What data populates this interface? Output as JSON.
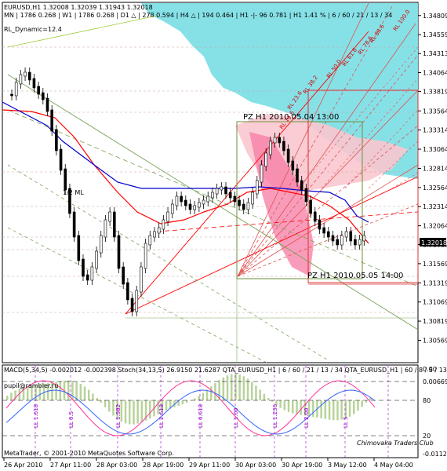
{
  "header": {
    "symbol_line": "EURUSD,H1  1.32008 1.32039 1.31943 1.32018",
    "timeframe_line": "MN | 1786   0.268 | W1 | 1786   0.268 | D1 △ | 278   0.594 | H4 △ | 194   0.464 | H1 -|- 96   0.781 | H1  1.41 %  | 6 / 60 / 21 / 13 / 34",
    "indicator_name": "RL_Dynamic=12.4",
    "subwindow_line": "MACD(5,34,5) -0.002012 -0.002398   Stoch(34,13,5) 26.9150 21.6287   QTA_EURUSD_H1  | 6 / 60 / 21 / 13 / 34   QTA_EURUSD_H1  | 60 / 8 / 5 / 13",
    "email_line": "pupil@rambler.ru",
    "copyright": "MetaTrader, © 2001-2010 MetaQuotes Software Corp.",
    "club": "Chimovaka Traders Club"
  },
  "annotations": {
    "pz_top": "PZ H1  2010.05.04 13:00",
    "pz_bottom": "PZ H1   2010.05.05 14:00",
    "ml_label": "1/2 ML",
    "fan_labels": [
      "RL 100.0",
      "RL 88.6",
      "RL 78.6",
      "RL 61.8",
      "RL 50.0",
      "RL 38.2",
      "RL 23.6",
      "RL 14.6"
    ],
    "sub_labels": [
      "LL 1.618",
      "LL 0.5",
      "LL 1.382",
      "LL 2.618",
      "LL 0.618",
      "LL 1.00",
      "LL 1.236",
      "LL 2.00",
      "LL 5"
    ]
  },
  "colors": {
    "cyan_cloud": "#7fdfe6",
    "pink_cloud": "#f9c7cf",
    "pink_strong": "#f77ba4",
    "median_red": "#ff0000",
    "median_blue": "#0000cc",
    "green_channel": "#7aa35a",
    "bull_candle": "#ffffff",
    "bear_candle": "#000000",
    "stoch_main": "#ff3399",
    "stoch_signal": "#3366ff",
    "macd_hist": "#b8d39a"
  },
  "chart_data": {
    "type": "candlestick",
    "title": "EURUSD,H1",
    "y_axis": {
      "ticks": [
        "1.34809",
        "1.34559",
        "1.34313",
        "1.34064",
        "1.33819",
        "1.33564",
        "1.33314",
        "1.33064",
        "1.32814",
        "1.32564",
        "1.32314",
        "1.32064",
        "1.32018",
        "1.31819",
        "1.31569",
        "1.31319",
        "1.31069",
        "1.30819",
        "1.30569"
      ],
      "range": [
        1.3042,
        1.3494
      ],
      "current_price": 1.32018
    },
    "sub_y_axis": {
      "ticks": [
        "0.00",
        "0.006695",
        "80",
        "20",
        "-0.01123"
      ]
    },
    "x_axis": {
      "labels": [
        "26 Apr 2010",
        "27 Apr 11:00",
        "28 Apr 03:00",
        "28 Apr 19:00",
        "29 Apr 11:00",
        "30 Apr 03:00",
        "30 Apr 19:00",
        "3 May 12:00",
        "4 May 04:00"
      ]
    },
    "pz_levels": [
      "2010.05.04 13:00",
      "2010.05.05 14:00"
    ]
  }
}
